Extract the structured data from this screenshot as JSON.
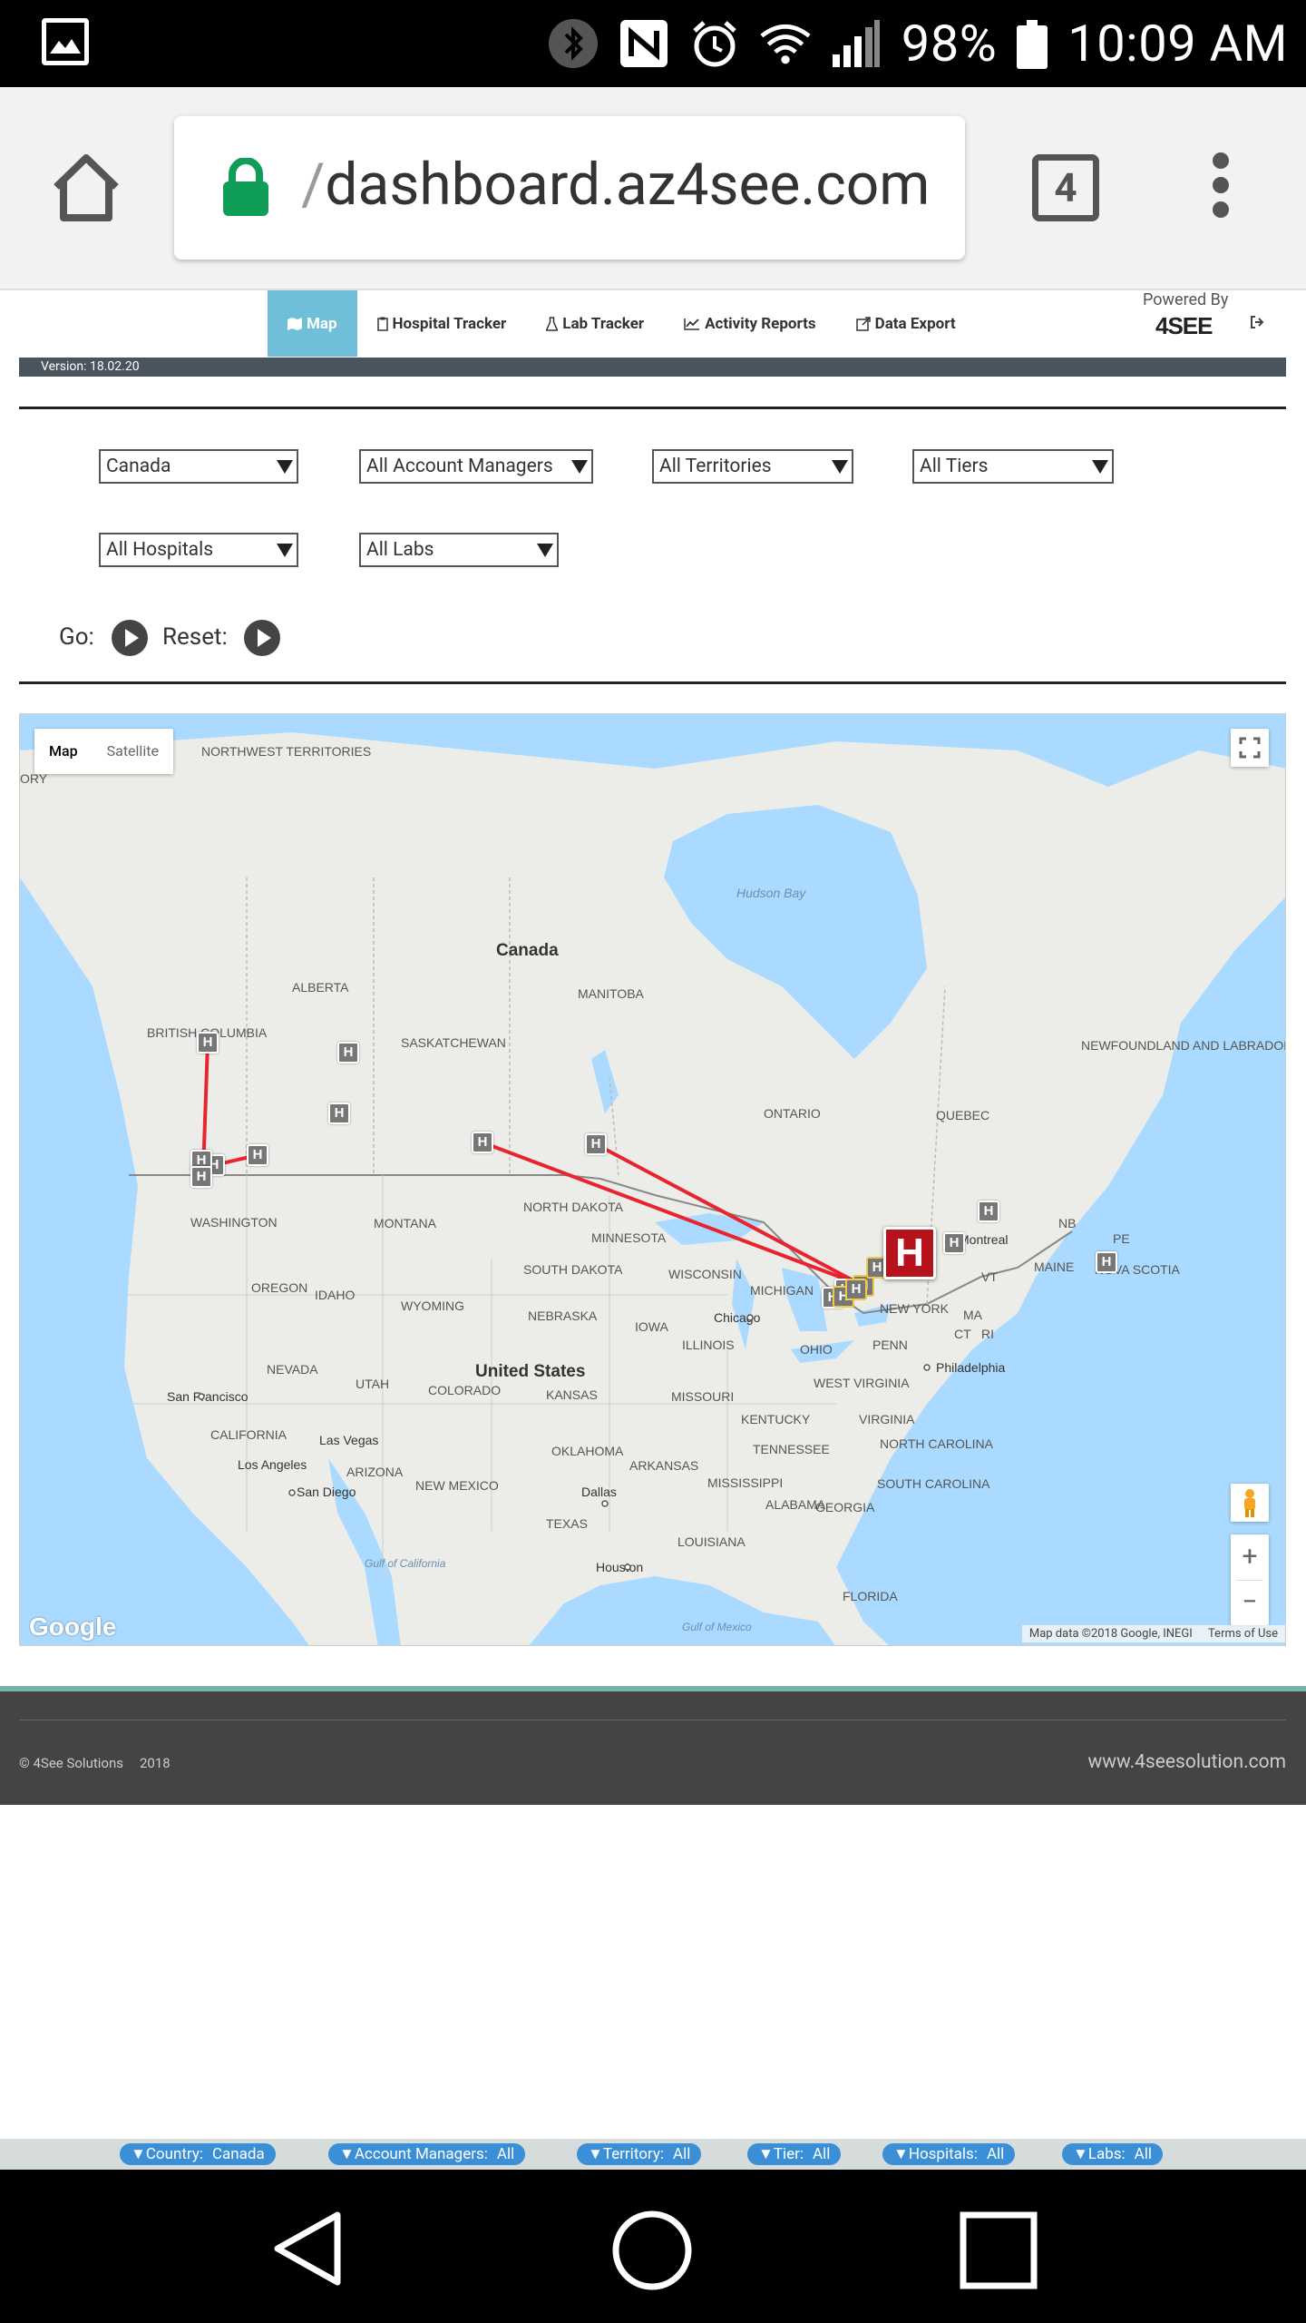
{
  "status_bar": {
    "battery": "98%",
    "time": "10:09 AM",
    "icons": [
      "image-notification-icon",
      "bluetooth-icon",
      "nfc-icon",
      "alarm-icon",
      "wifi-icon",
      "signal-icon",
      "battery-icon"
    ]
  },
  "browser": {
    "url_prefix": "/",
    "url": "dashboard.az4see.com",
    "tab_count": "4"
  },
  "nav": {
    "items": [
      {
        "label": "Map",
        "icon": "map-icon",
        "active": true
      },
      {
        "label": "Hospital Tracker",
        "icon": "clipboard-icon",
        "active": false
      },
      {
        "label": "Lab Tracker",
        "icon": "flask-icon",
        "active": false
      },
      {
        "label": "Activity Reports",
        "icon": "line-chart-icon",
        "active": false
      },
      {
        "label": "Data Export",
        "icon": "export-icon",
        "active": false
      }
    ],
    "powered_by": "Powered By",
    "brand": "4SEE"
  },
  "version": "Version: 18.02.20",
  "filters": {
    "country": "Canada",
    "account_managers": "All Account Managers",
    "territories": "All Territories",
    "tiers": "All Tiers",
    "hospitals": "All Hospitals",
    "labs": "All Labs",
    "go_label": "Go:",
    "reset_label": "Reset:"
  },
  "map": {
    "type_map": "Map",
    "type_satellite": "Satellite",
    "zoom_in": "+",
    "zoom_out": "−",
    "google": "Google",
    "attribution": "Map data ©2018 Google, INEGI",
    "terms": "Terms of Use",
    "labels": {
      "hudson_bay": "Hudson Bay",
      "canada": "Canada",
      "nw_territories": "NORTHWEST TERRITORIES",
      "alberta": "ALBERTA",
      "manitoba": "MANITOBA",
      "saskatchewan": "SASKATCHEWAN",
      "british_columbia": "BRITISH COLUMBIA",
      "ontario": "ONTARIO",
      "quebec": "QUEBEC",
      "newfoundland": "NEWFOUNDLAND AND LABRADOR",
      "nb": "NB",
      "pe": "PE",
      "nova_scotia": "NOVA SCOTIA",
      "montreal": "Montreal",
      "maine": "MAINE",
      "vt": "VT",
      "ny": "NEW YORK",
      "ma": "MA",
      "ct": "CT",
      "ri": "RI",
      "washington": "WASHINGTON",
      "montana": "MONTANA",
      "north_dakota": "NORTH DAKOTA",
      "minnesota": "MINNESOTA",
      "south_dakota": "SOUTH DAKOTA",
      "wisconsin": "WISCONSIN",
      "michigan": "MICHIGAN",
      "oregon": "OREGON",
      "idaho": "IDAHO",
      "wyoming": "WYOMING",
      "nebraska": "NEBRASKA",
      "iowa": "IOWA",
      "chicago": "Chicago",
      "illinois": "ILLINOIS",
      "ohio": "OHIO",
      "penn": "PENN",
      "philadelphia": "Philadelphia",
      "nevada": "NEVADA",
      "utah": "UTAH",
      "colorado": "COLORADO",
      "united_states": "United States",
      "kansas": "KANSAS",
      "missouri": "MISSOURI",
      "west_virginia": "WEST VIRGINIA",
      "virginia": "VIRGINIA",
      "kentucky": "KENTUCKY",
      "san_francisco": "San Francisco",
      "california": "CALIFORNIA",
      "las_vegas": "Las Vegas",
      "los_angeles": "Los Angeles",
      "arizona": "ARIZONA",
      "san_diego": "San Diego",
      "new_mexico": "NEW MEXICO",
      "oklahoma": "OKLAHOMA",
      "arkansas": "ARKANSAS",
      "tennessee": "TENNESSEE",
      "north_carolina": "NORTH CAROLINA",
      "south_carolina": "SOUTH CAROLINA",
      "dallas": "Dallas",
      "mississippi": "MISSISSIPPI",
      "alabama": "ALABAMA",
      "georgia": "GEORGIA",
      "texas": "TEXAS",
      "louisiana": "LOUISIANA",
      "houston": "Houston",
      "florida": "FLORIDA",
      "gulf_california": "Gulf of California",
      "gulf_mexico": "Gulf of Mexico",
      "ory": "ORY"
    },
    "marker_letter": "H"
  },
  "footer": {
    "copyright": "© 4See Solutions",
    "year": "2018",
    "website": "www.4seesolution.com"
  },
  "chips": [
    {
      "key": "Country:",
      "value": "Canada"
    },
    {
      "key": "Account Managers:",
      "value": "All"
    },
    {
      "key": "Territory:",
      "value": "All"
    },
    {
      "key": "Tier:",
      "value": "All"
    },
    {
      "key": "Hospitals:",
      "value": "All"
    },
    {
      "key": "Labs:",
      "value": "All"
    }
  ],
  "colors": {
    "nav_active": "#6fbfd8",
    "route": "#e8242e",
    "marker_large": "#b5121b",
    "marker": "#777777",
    "chip": "#3a8fd6",
    "footer": "#444444",
    "water": "#aadaff"
  }
}
